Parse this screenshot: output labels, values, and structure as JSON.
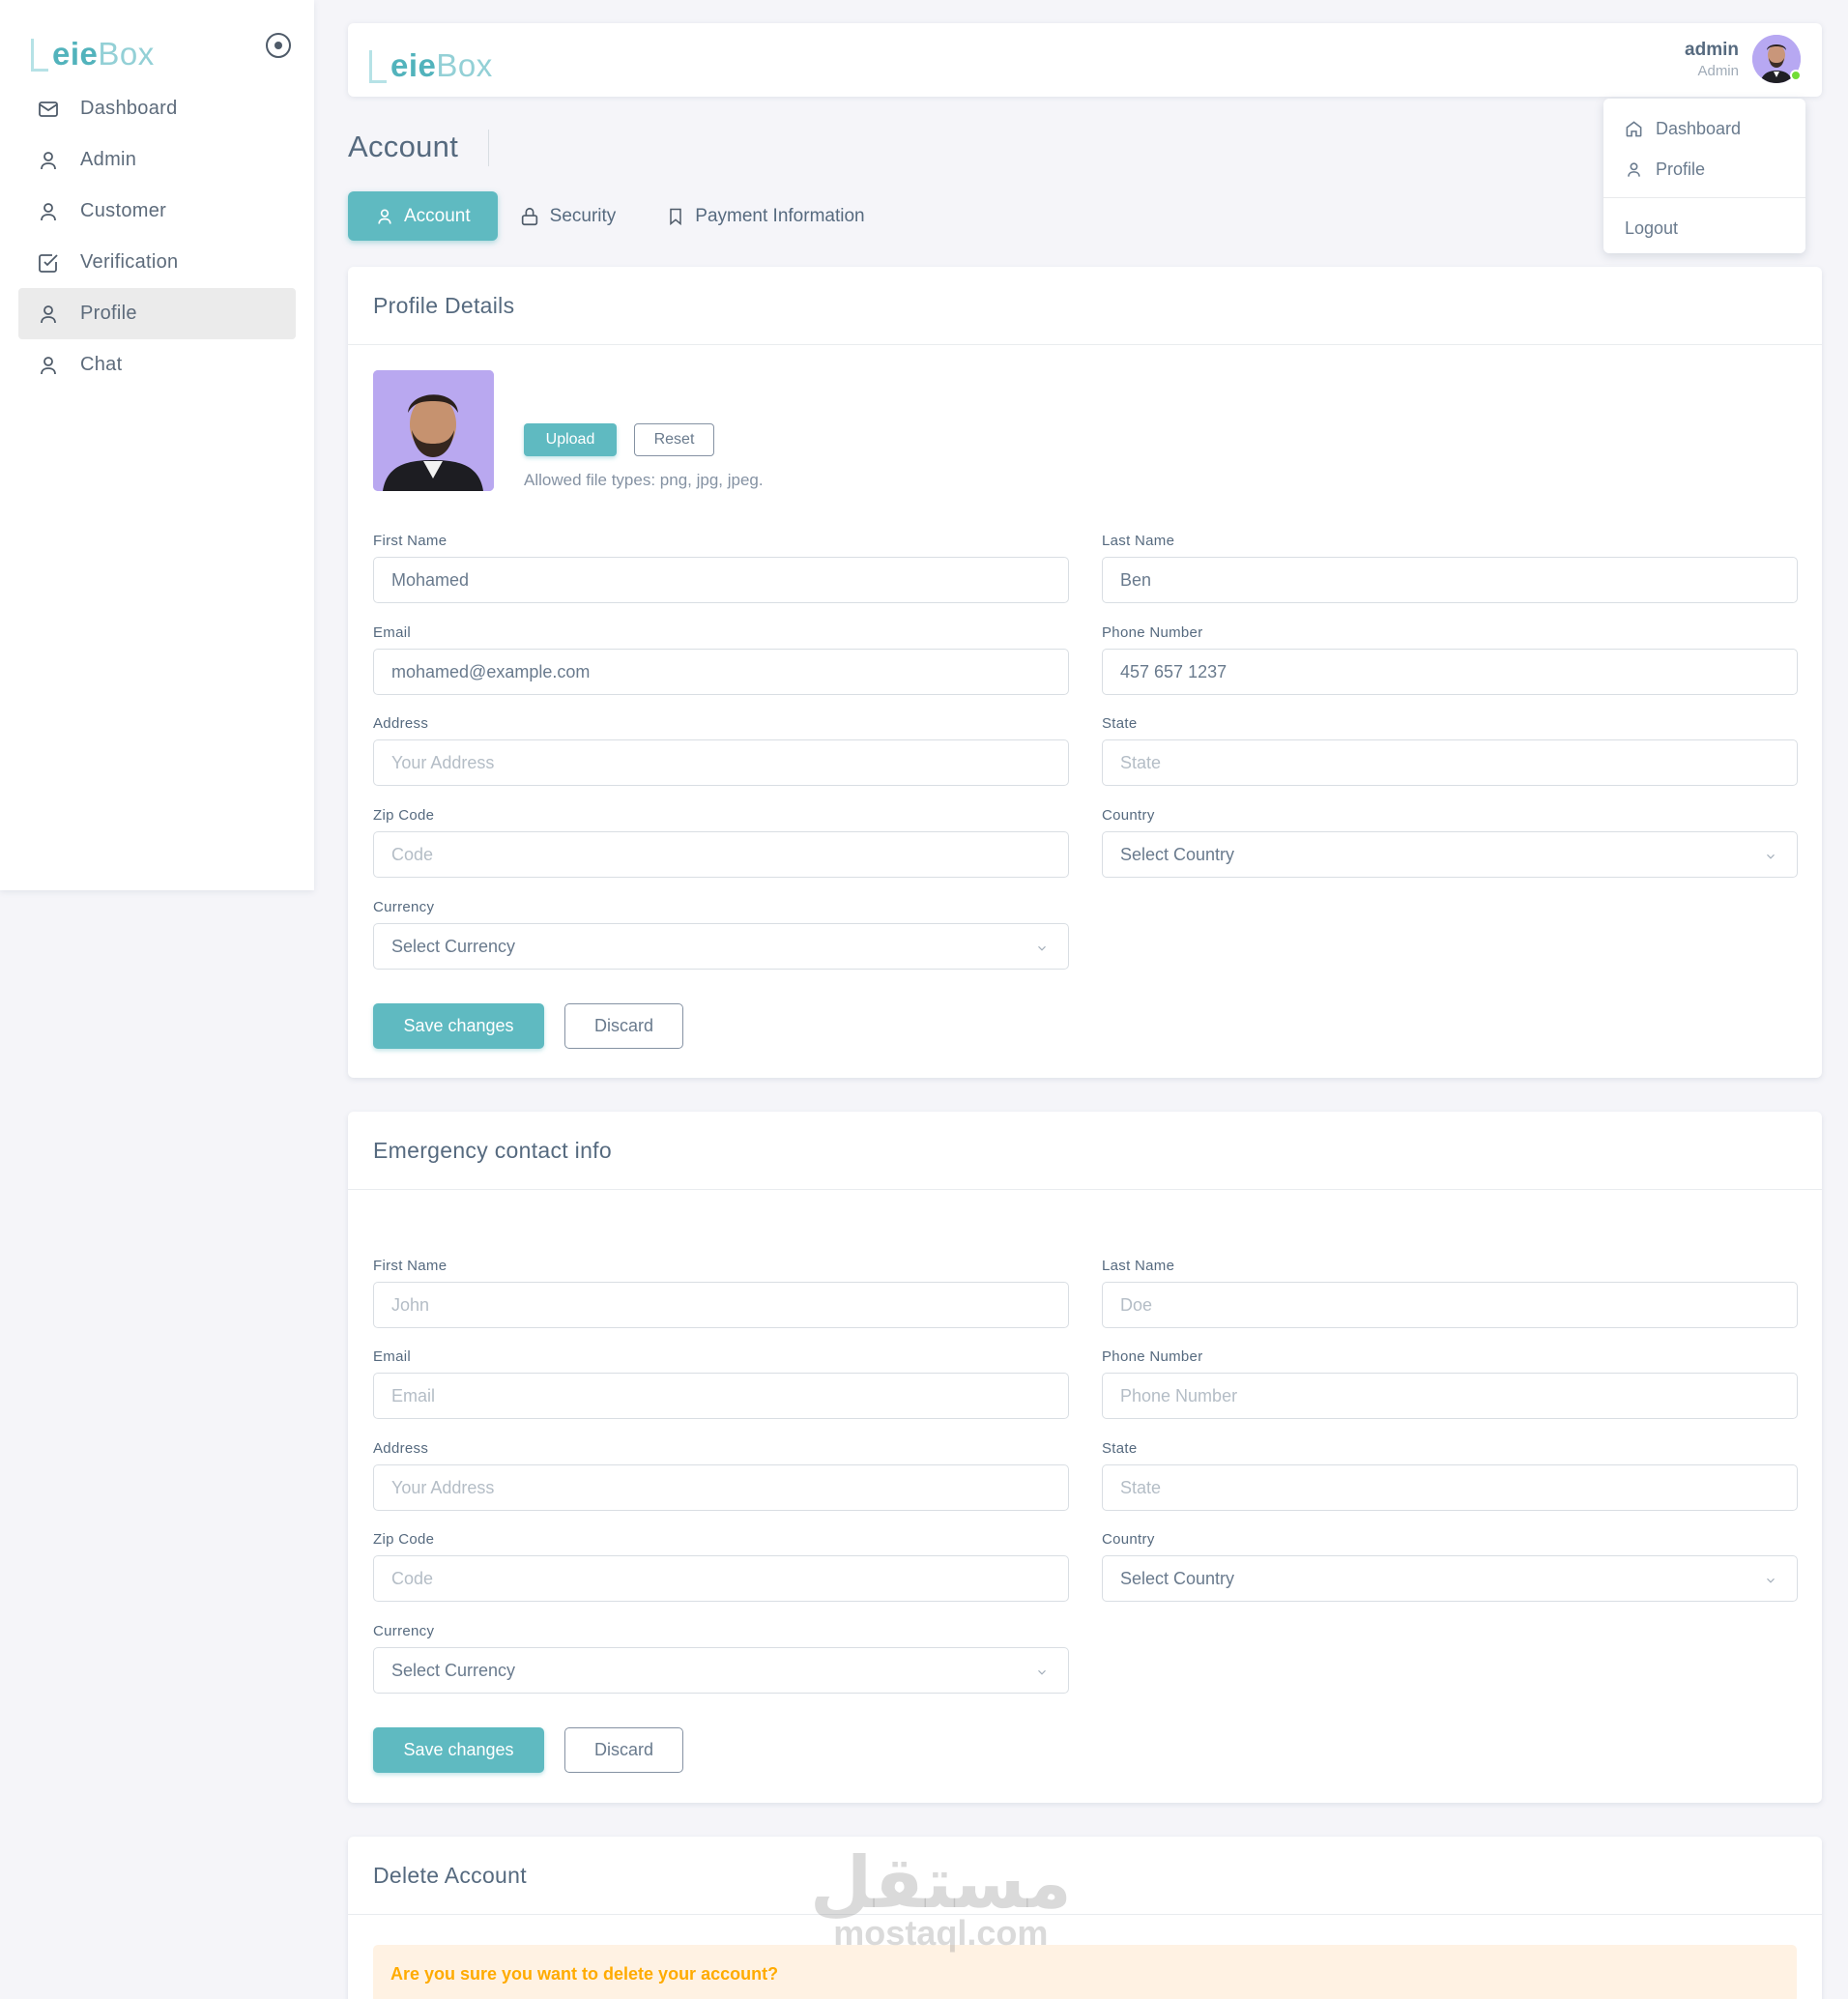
{
  "brand": {
    "part1": "eie",
    "part2": "Box"
  },
  "sidebar": {
    "items": [
      {
        "label": "Dashboard",
        "icon": "mail-icon"
      },
      {
        "label": "Admin",
        "icon": "user-icon"
      },
      {
        "label": "Customer",
        "icon": "user-icon"
      },
      {
        "label": "Verification",
        "icon": "check-square-icon"
      },
      {
        "label": "Profile",
        "icon": "user-icon",
        "active": true
      },
      {
        "label": "Chat",
        "icon": "user-icon"
      }
    ]
  },
  "user": {
    "name": "admin",
    "role": "Admin"
  },
  "dropdown": {
    "dashboard": "Dashboard",
    "profile": "Profile",
    "logout": "Logout"
  },
  "page": {
    "title": "Account"
  },
  "tabs": [
    {
      "label": "Account",
      "icon": "user-icon",
      "active": true
    },
    {
      "label": "Security",
      "icon": "lock-icon"
    },
    {
      "label": "Payment Information",
      "icon": "bookmark-icon"
    }
  ],
  "profile": {
    "header": "Profile Details",
    "upload_label": "Upload",
    "reset_label": "Reset",
    "allowed_note": "Allowed file types: png, jpg, jpeg.",
    "first_name": {
      "label": "First Name",
      "value": "Mohamed"
    },
    "last_name": {
      "label": "Last Name",
      "value": "Ben"
    },
    "email": {
      "label": "Email",
      "value": "mohamed@example.com"
    },
    "phone": {
      "label": "Phone Number",
      "value": "457 657 1237"
    },
    "address": {
      "label": "Address",
      "placeholder": "Your Address"
    },
    "state": {
      "label": "State",
      "placeholder": "State"
    },
    "zip": {
      "label": "Zip Code",
      "placeholder": "Code"
    },
    "country": {
      "label": "Country",
      "value": "Select Country"
    },
    "currency": {
      "label": "Currency",
      "value": "Select Currency"
    },
    "save_label": "Save changes",
    "discard_label": "Discard"
  },
  "emergency": {
    "header": "Emergency contact info",
    "first_name": {
      "label": "First Name",
      "placeholder": "John"
    },
    "last_name": {
      "label": "Last Name",
      "placeholder": "Doe"
    },
    "email": {
      "label": "Email",
      "placeholder": "Email"
    },
    "phone": {
      "label": "Phone Number",
      "placeholder": "Phone Number"
    },
    "address": {
      "label": "Address",
      "placeholder": "Your Address"
    },
    "state": {
      "label": "State",
      "placeholder": "State"
    },
    "zip": {
      "label": "Zip Code",
      "placeholder": "Code"
    },
    "country": {
      "label": "Country",
      "value": "Select Country"
    },
    "currency": {
      "label": "Currency",
      "value": "Select Currency"
    },
    "save_label": "Save changes",
    "discard_label": "Discard"
  },
  "delete": {
    "header": "Delete Account",
    "warning": "Are you sure you want to delete your account?"
  },
  "watermark": {
    "arabic": "مستقل",
    "latin": "mostaql.com"
  },
  "colors": {
    "primary": "#5fbac1",
    "text": "#566a7f",
    "warning": "#ffab00",
    "warning_bg": "#fff2e3"
  }
}
